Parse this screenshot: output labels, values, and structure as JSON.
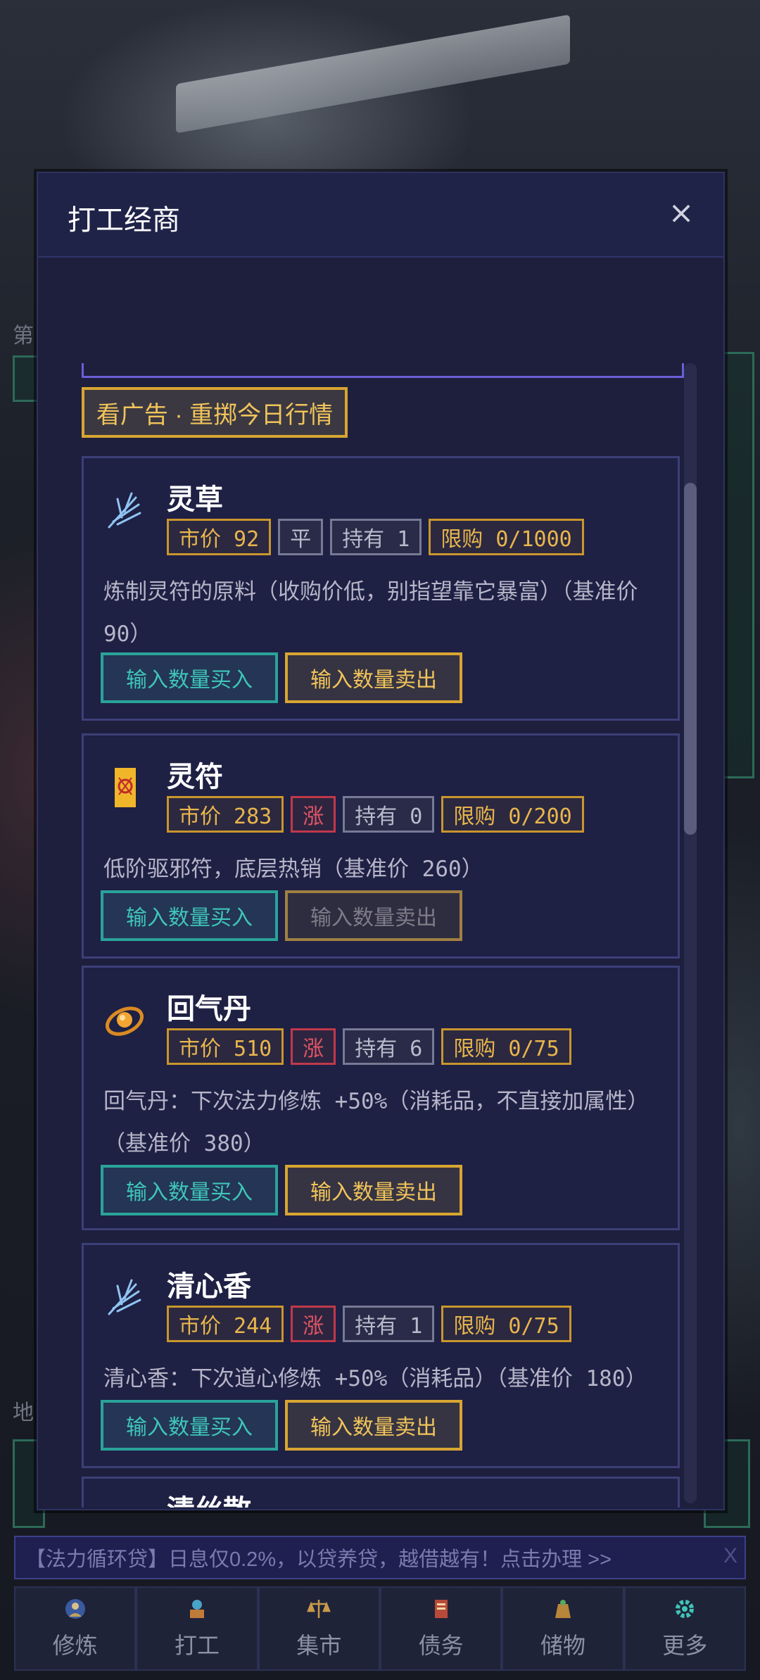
{
  "modal": {
    "title": "打工经商",
    "close_glyph": "×"
  },
  "ad_button": {
    "label": "看广告 · 重掷今日行情"
  },
  "items": [
    {
      "name": "灵草",
      "icon": "herb-icon",
      "price": "市价 92",
      "trend": "平",
      "held": "持有 1",
      "limit": "限购 0/1000",
      "description": "炼制灵符的原料（收购价低，别指望靠它暴富）（基准价 90）",
      "buy_label": "输入数量买入",
      "sell_label": "输入数量卖出"
    },
    {
      "name": "灵符",
      "icon": "talisman-icon",
      "price": "市价 283",
      "trend": "涨",
      "held": "持有 0",
      "limit": "限购 0/200",
      "description": "低阶驱邪符，底层热销（基准价 260）",
      "buy_label": "输入数量买入",
      "sell_label": "输入数量卖出"
    },
    {
      "name": "回气丹",
      "icon": "pill-icon",
      "price": "市价 510",
      "trend": "涨",
      "held": "持有 6",
      "limit": "限购 0/75",
      "description": "回气丹：下次法力修炼 +50%（消耗品，不直接加属性）（基准价 380）",
      "buy_label": "输入数量买入",
      "sell_label": "输入数量卖出"
    },
    {
      "name": "清心香",
      "icon": "incense-icon",
      "price": "市价 244",
      "trend": "涨",
      "held": "持有 1",
      "limit": "限购 0/75",
      "description": "清心香：下次道心修炼 +50%（消耗品）（基准价 180）",
      "buy_label": "输入数量买入",
      "sell_label": "输入数量卖出"
    },
    {
      "name": "清丝散"
    }
  ],
  "banner": {
    "text": "【法力循环贷】日息仅0.2%，以贷养贷，越借越有！点击办理 >>",
    "close": "X"
  },
  "nav": [
    {
      "label": "修炼",
      "icon": "cultivate-icon"
    },
    {
      "label": "打工",
      "icon": "work-icon"
    },
    {
      "label": "集市",
      "icon": "market-scale-icon"
    },
    {
      "label": "债务",
      "icon": "debt-scroll-icon"
    },
    {
      "label": "储物",
      "icon": "storage-bag-icon"
    },
    {
      "label": "更多",
      "icon": "gear-icon"
    }
  ],
  "background": {
    "left_label_top": "第",
    "left_label_bottom": "地"
  },
  "colors": {
    "gold": "#d8a531",
    "teal": "#2aa39a",
    "red": "#c0394a",
    "panel": "#1d1f3d"
  }
}
